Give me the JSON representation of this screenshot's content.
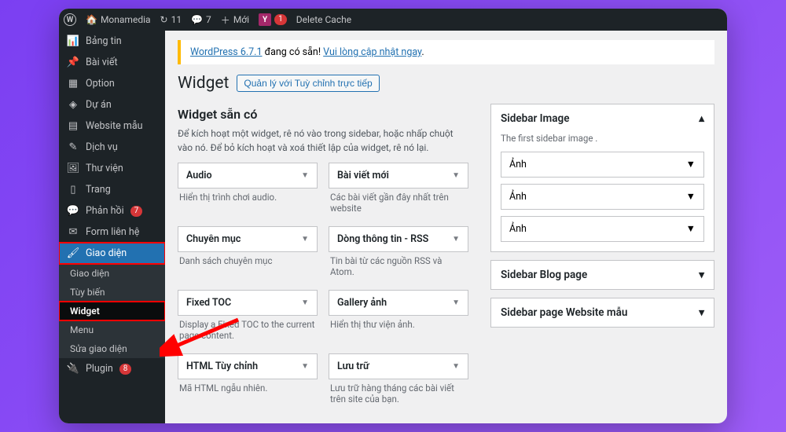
{
  "adminbar": {
    "site": "Monamedia",
    "updates": "11",
    "comments": "7",
    "new": "Mới",
    "yoast_badge": "1",
    "delete_cache": "Delete Cache"
  },
  "sidebar": {
    "items": [
      {
        "icon": "📊",
        "label": "Bảng tin"
      },
      {
        "icon": "📌",
        "label": "Bài viết"
      },
      {
        "icon": "▦",
        "label": "Option"
      },
      {
        "icon": "◈",
        "label": "Dự án"
      },
      {
        "icon": "▤",
        "label": "Website mẫu"
      },
      {
        "icon": "✎",
        "label": "Dịch vụ"
      },
      {
        "icon": "🖼",
        "label": "Thư viện"
      },
      {
        "icon": "▯",
        "label": "Trang"
      },
      {
        "icon": "💬",
        "label": "Phản hồi",
        "count": "7"
      },
      {
        "icon": "✉",
        "label": "Form liên hệ"
      },
      {
        "icon": "🖌",
        "label": "Giao diện",
        "active": true
      }
    ],
    "submenu": [
      "Giao diện",
      "Tùy biến",
      "Widget",
      "Menu",
      "Sửa giao diện"
    ],
    "plugin": {
      "icon": "🔌",
      "label": "Plugin",
      "count": "8"
    }
  },
  "notice": {
    "link1": "WordPress 6.7.1",
    "text1": " đang có sẵn! ",
    "link2": "Vui lòng cập nhật ngay",
    "dot": "."
  },
  "page": {
    "title": "Widget",
    "manage_btn": "Quản lý với Tuỳ chỉnh trực tiếp"
  },
  "available": {
    "heading": "Widget sẵn có",
    "desc": "Để kích hoạt một widget, rê nó vào trong sidebar, hoặc nhấp chuột vào nó. Để bỏ kích hoạt và xoá thiết lập của widget, rê nó lại.",
    "widgets": [
      {
        "title": "Audio",
        "desc": "Hiển thị trình chơi audio."
      },
      {
        "title": "Bài viết mới",
        "desc": "Các bài viết gần đây nhất trên website"
      },
      {
        "title": "Chuyên mục",
        "desc": "Danh sách chuyên mục"
      },
      {
        "title": "Dòng thông tin - RSS",
        "desc": "Tin bài từ các nguồn RSS và Atom."
      },
      {
        "title": "Fixed TOC",
        "desc": "Display a Fixed TOC to the current page content."
      },
      {
        "title": "Gallery ảnh",
        "desc": "Hiển thị thư viện ảnh."
      },
      {
        "title": "HTML Tùy chỉnh",
        "desc": "Mã HTML ngẫu nhiên."
      },
      {
        "title": "Lưu trữ",
        "desc": "Lưu trữ hàng tháng các bài viết trên site của bạn."
      }
    ]
  },
  "areas": {
    "a1": {
      "title": "Sidebar Image",
      "desc": "The first sidebar image .",
      "widgets": [
        "Ảnh",
        "Ảnh",
        "Ảnh"
      ]
    },
    "a2": {
      "title": "Sidebar Blog page"
    },
    "a3": {
      "title": "Sidebar page Website mẫu"
    }
  }
}
